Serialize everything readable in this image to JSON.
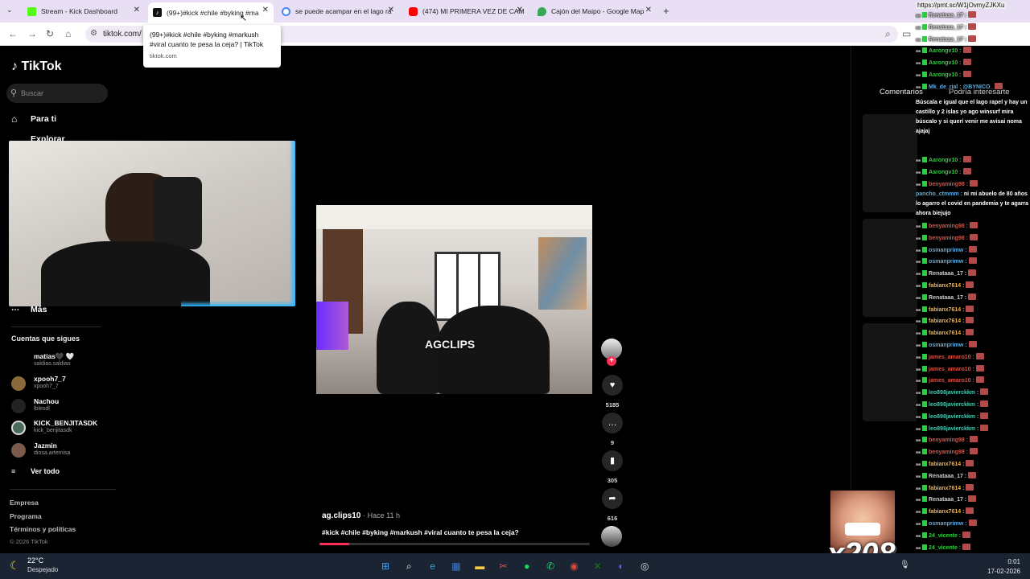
{
  "browser": {
    "tabs": [
      {
        "label": "Stream - Kick Dashboard",
        "icon": "kick-icon",
        "color": "#53fc18"
      },
      {
        "label": "(99+)#kick #chile #byking #ma",
        "icon": "tiktok-icon",
        "color": "#000000"
      },
      {
        "label": "se puede acampar en el lago ra",
        "icon": "google-icon",
        "color": "#4285f4"
      },
      {
        "label": "(474) MI PRIMERA VEZ DE CAM",
        "icon": "youtube-icon",
        "color": "#ff0000"
      },
      {
        "label": "Cajón del Maipo - Google Map",
        "icon": "maps-icon",
        "color": "#34a853"
      }
    ],
    "new_tab": "+",
    "url": "tiktok.com/",
    "tooltip": {
      "title": "(99+)#kick #chile #byking #markush #viral cuanto te pesa la ceja? | TikTok",
      "domain": "tiktok.com"
    }
  },
  "tiktok": {
    "logo": "TikTok",
    "search_placeholder": "Buscar",
    "nav": [
      {
        "label": "Para ti",
        "icon": "home-icon"
      },
      {
        "label": "Explorar",
        "icon": "compass-icon"
      },
      {
        "label": "Más",
        "icon": "more-icon"
      }
    ],
    "following_title": "Cuentas que sigues",
    "accounts": [
      {
        "name": "matias🖤 🤍",
        "handle": "saldias.saldias"
      },
      {
        "name": "xpooh7_7",
        "handle": "xpooh7_7"
      },
      {
        "name": "Nachou",
        "handle": "lblesdl"
      },
      {
        "name": "KICK_BENJITASDK",
        "handle": "kick_benjitasdk"
      },
      {
        "name": "Jazmin",
        "handle": "diosa.artemisa"
      }
    ],
    "see_all": "Ver todo",
    "footer": [
      "Empresa",
      "Programa",
      "Términos y políticas",
      "© 2026 TikTok"
    ],
    "video": {
      "watermark": "AGCLIPS",
      "author": "ag.clips10",
      "time": "· Hace 11 h",
      "description": "#kick #chile #byking #markush #viral cuanto te pesa la ceja?",
      "progress": 0.11
    },
    "actions": {
      "likes": "5185",
      "comments": "9",
      "saves": "305",
      "shares": "616"
    },
    "right_tabs": [
      "Comentarios",
      "Podría interesarte"
    ]
  },
  "chat": {
    "url": "https://pmt.sc/W1jOvmyZJKXu",
    "lines": [
      {
        "u": "Renataaa_17 :",
        "c": "#cccccc"
      },
      {
        "u": "Renataaa_17 :",
        "c": "#cccccc"
      },
      {
        "u": "Renataaa_17 :",
        "c": "#cccccc"
      },
      {
        "u": "Aarongv10 :",
        "c": "#2ecc40"
      },
      {
        "u": "Aarongv10 :",
        "c": "#2ecc40"
      },
      {
        "u": "Aarongv10 :",
        "c": "#2ecc40"
      },
      {
        "u": "Mk_de_rial : @BYNICO_",
        "c": "#5dade2"
      }
    ],
    "long1": "Búscala e igual que el lago rapel y hay un castillo y 2 islas yo ago winsurf mira búscalo y si querí venir me avisai noma ajajaj",
    "lines2": [
      {
        "u": "Aarongv10 :",
        "c": "#2ecc40"
      },
      {
        "u": "Aarongv10 :",
        "c": "#2ecc40"
      },
      {
        "u": "benyaming98 :",
        "c": "#e74c3c"
      }
    ],
    "long2_user": "pancho_ctmmm :",
    "long2": "ni mi abuelo de 80 años lo agarro el covid en pandemia y te agarra ahora biejujo",
    "lines3": [
      {
        "u": "benyaming98 :",
        "c": "#e74c3c"
      },
      {
        "u": "benyaming98 :",
        "c": "#e74c3c"
      },
      {
        "u": "osmanprimw :",
        "c": "#5dade2"
      },
      {
        "u": "osmanprimw :",
        "c": "#5dade2"
      },
      {
        "u": "Renataaa_17 :",
        "c": "#cccccc"
      },
      {
        "u": "fabianx7614 :",
        "c": "#f5b041"
      },
      {
        "u": "Renataaa_17 :",
        "c": "#cccccc"
      },
      {
        "u": "fabianx7614 :",
        "c": "#f5b041"
      },
      {
        "u": "fabianx7614 :",
        "c": "#f5b041"
      },
      {
        "u": "fabianx7614 :",
        "c": "#f5b041"
      },
      {
        "u": "osmanprimw :",
        "c": "#5dade2"
      },
      {
        "u": "james_amaro10 :",
        "c": "#e74c3c"
      },
      {
        "u": "james_amaro10 :",
        "c": "#e74c3c"
      },
      {
        "u": "james_amaro10 :",
        "c": "#e74c3c"
      },
      {
        "u": "leo898javierckkm :",
        "c": "#48c9b0"
      },
      {
        "u": "leo898javierckkm :",
        "c": "#48c9b0"
      },
      {
        "u": "leo898javierckkm :",
        "c": "#48c9b0"
      },
      {
        "u": "leo898javierckkm :",
        "c": "#48c9b0"
      },
      {
        "u": "benyaming98 :",
        "c": "#e74c3c"
      },
      {
        "u": "benyaming98 :",
        "c": "#e74c3c"
      },
      {
        "u": "fabianx7614 :",
        "c": "#f5b041"
      },
      {
        "u": "Renataaa_17 :",
        "c": "#cccccc"
      },
      {
        "u": "fabianx7614 :",
        "c": "#f5b041"
      },
      {
        "u": "Renataaa_17 :",
        "c": "#cccccc"
      },
      {
        "u": "fabianx7614 :",
        "c": "#f5b041"
      },
      {
        "u": "osmanprimw :",
        "c": "#5dade2"
      },
      {
        "u": "24_vicente :",
        "c": "#2ecc40"
      },
      {
        "u": "24_vicente :",
        "c": "#2ecc40"
      },
      {
        "u": "24_vicente :",
        "c": "#2ecc40"
      }
    ],
    "emote_count": "x208"
  },
  "taskbar": {
    "temp": "22°C",
    "weather": "Despejado",
    "time": "0:01",
    "date": "17-02-2026",
    "apps": [
      "windows-icon",
      "search-icon",
      "edge-icon",
      "store-icon",
      "folder-icon",
      "snipping-icon",
      "spotify-icon",
      "whatsapp-icon",
      "chrome-icon",
      "xbox-icon",
      "discord-icon",
      "obs-icon"
    ]
  }
}
